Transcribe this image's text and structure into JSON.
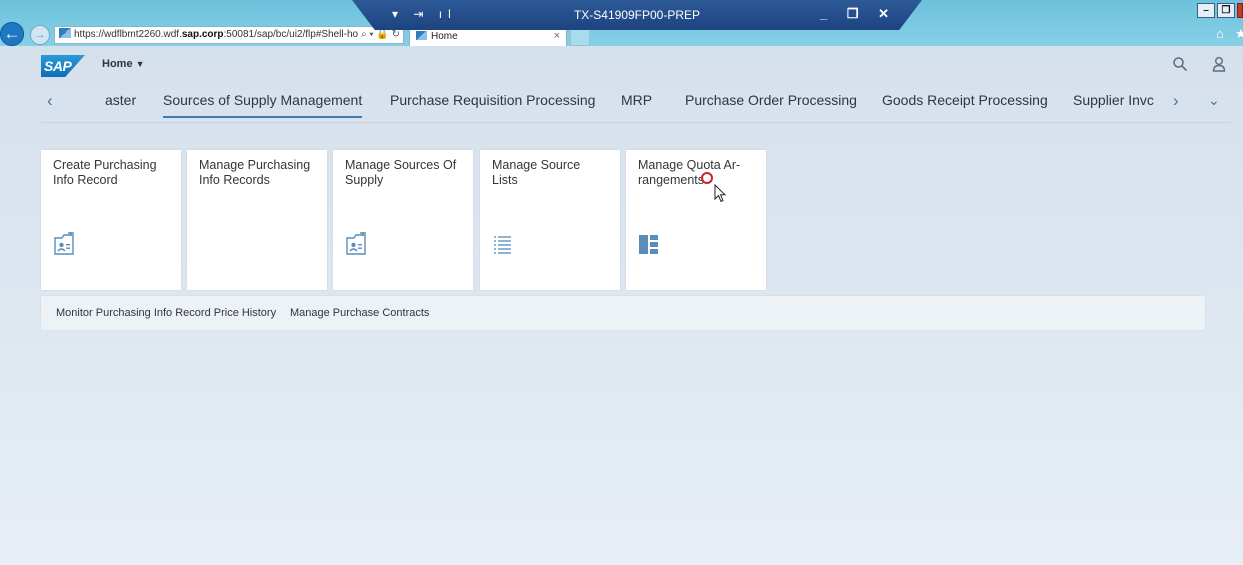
{
  "browser": {
    "url_prefix": "https://wdflbmt2260.wdf.",
    "url_domain": "sap.corp",
    "url_suffix": ":50081/sap/bc/ui2/flp#Shell-ho",
    "url_tools": "⌕ ▾ 🔒 ↻",
    "tab_title": "Home",
    "tab_close": "×",
    "home_glyph": "⌂",
    "star_glyph": "★"
  },
  "window_controls": {
    "minimize": "–",
    "restore": "❐",
    "close": ""
  },
  "rdp": {
    "left_controls": "▾ ⇥ ıl",
    "title": "TX-S41909FP00-PREP",
    "right_controls": "_ ❐ ✕"
  },
  "shell": {
    "logo_text": "SAP",
    "home_menu_label": "Home",
    "home_menu_caret": "▼",
    "icons": [
      "search-icon",
      "user-icon"
    ]
  },
  "anchor_nav": {
    "prev_glyph": "‹",
    "next_glyph": "›",
    "overflow_glyph": "⌄",
    "items": [
      {
        "label": "aster",
        "selected": false
      },
      {
        "label": "Sources of Supply Management",
        "selected": true
      },
      {
        "label": "Purchase Requisition Processing",
        "selected": false
      },
      {
        "label": "MRP",
        "selected": false
      },
      {
        "label": "Purchase Order Processing",
        "selected": false
      },
      {
        "label": "Goods Receipt Processing",
        "selected": false
      },
      {
        "label": "Supplier Invc",
        "selected": false
      }
    ]
  },
  "tiles": [
    {
      "title": "Create Purchasing Info Record",
      "icon": "contact-card-icon"
    },
    {
      "title": "Manage Purchasing Info Records",
      "icon": ""
    },
    {
      "title": "Manage Sources Of Supply",
      "icon": "contact-card-icon"
    },
    {
      "title": "Manage Source Lists",
      "icon": "list-icon"
    },
    {
      "title": "Manage Quota Ar-rangements",
      "icon": "quota-layout-icon"
    }
  ],
  "link_tiles": [
    {
      "label": "Monitor Purchasing Info Record Price History"
    },
    {
      "label": "Manage Purchase Contracts"
    }
  ],
  "colors": {
    "accent": "#427cac",
    "text": "#32363a",
    "icon": "#5b8db8",
    "rdp_bar": "#1d4380",
    "chrome": "#6cc1dc"
  }
}
